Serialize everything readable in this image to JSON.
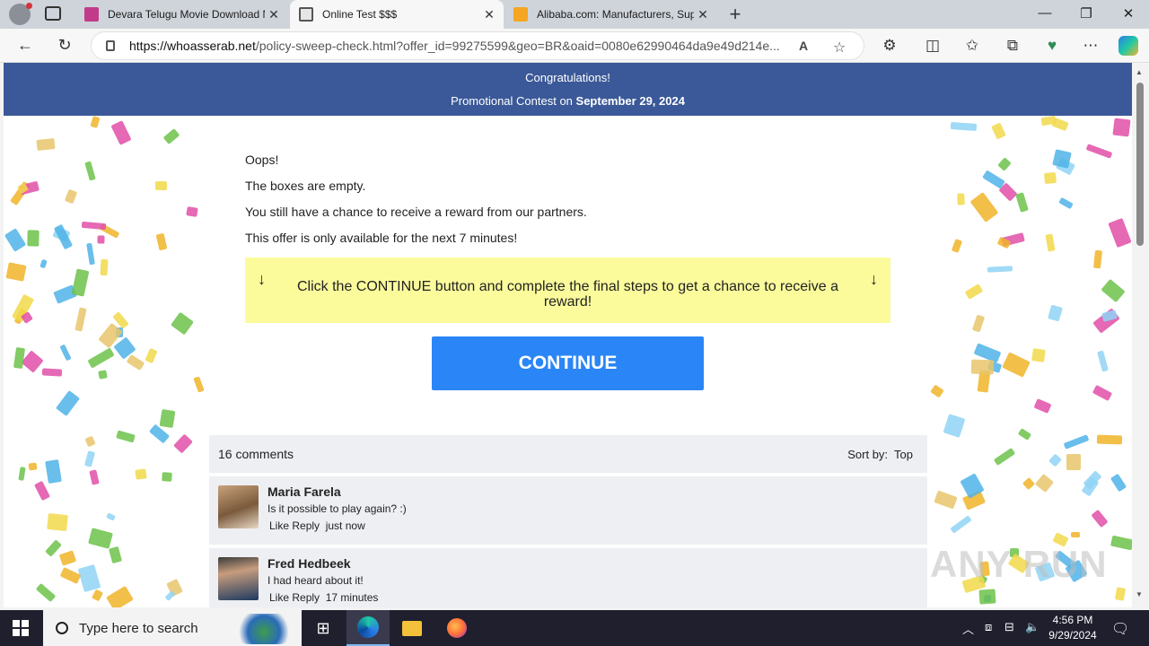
{
  "browser": {
    "tabs": [
      {
        "title": "Devara Telugu Movie Download M",
        "favicon_color": "#c23b8a",
        "active": false
      },
      {
        "title": "Online Test $$$",
        "favicon_color": "#555555",
        "active": true
      },
      {
        "title": "Alibaba.com: Manufacturers, Sup",
        "favicon_color": "#f5a623",
        "active": false
      }
    ],
    "tab_close": "✕",
    "new_tab": "+",
    "url_domain": "https://whoasserab.net",
    "url_path": "/policy-sweep-check.html?offer_id=99275599&geo=BR&oaid=0080e62990464da9e49d214e...",
    "window_controls": {
      "minimize": "—",
      "maximize": "❐",
      "close": "✕"
    },
    "nav": {
      "back": "←",
      "reload": "↻"
    },
    "toolbar_icons": {
      "read_aloud": "A",
      "favorite": "☆",
      "extensions": "⚙",
      "split": "◫",
      "favorites_bar": "✩",
      "collections": "⧉",
      "performance": "♥",
      "more": "⋯"
    }
  },
  "page": {
    "banner_line1": "Congratulations!",
    "banner_line2_prefix": "Promotional Contest on ",
    "banner_date": "September 29, 2024",
    "messages": [
      "Oops!",
      "The boxes are empty.",
      "You still have a chance to receive a reward from our partners.",
      "This offer is only available for the next 7 minutes!"
    ],
    "instruction": "Click the CONTINUE button and complete the final steps to get a chance to receive a reward!",
    "arrow_glyph": "↓",
    "continue_label": "CONTINUE",
    "comments_count": "16 comments",
    "sort_label": "Sort by:",
    "sort_value": "Top",
    "comments": [
      {
        "name": "Maria Farela",
        "text": "Is it possible to play again? :)",
        "like": "Like",
        "reply": "Reply",
        "time": "just now"
      },
      {
        "name": "Fred Hedbeek",
        "text": "I had heard about it!",
        "like": "Like",
        "reply": "Reply",
        "time": "17 minutes"
      }
    ],
    "watermark": "ANY RUN"
  },
  "taskbar": {
    "search_placeholder": "Type here to search",
    "time": "4:56 PM",
    "date": "9/29/2024"
  },
  "colors": {
    "banner": "#3b5998",
    "cta": "#2a86f7",
    "instruction_bg": "#fbfb9c",
    "comment_bg": "#edeff3"
  }
}
